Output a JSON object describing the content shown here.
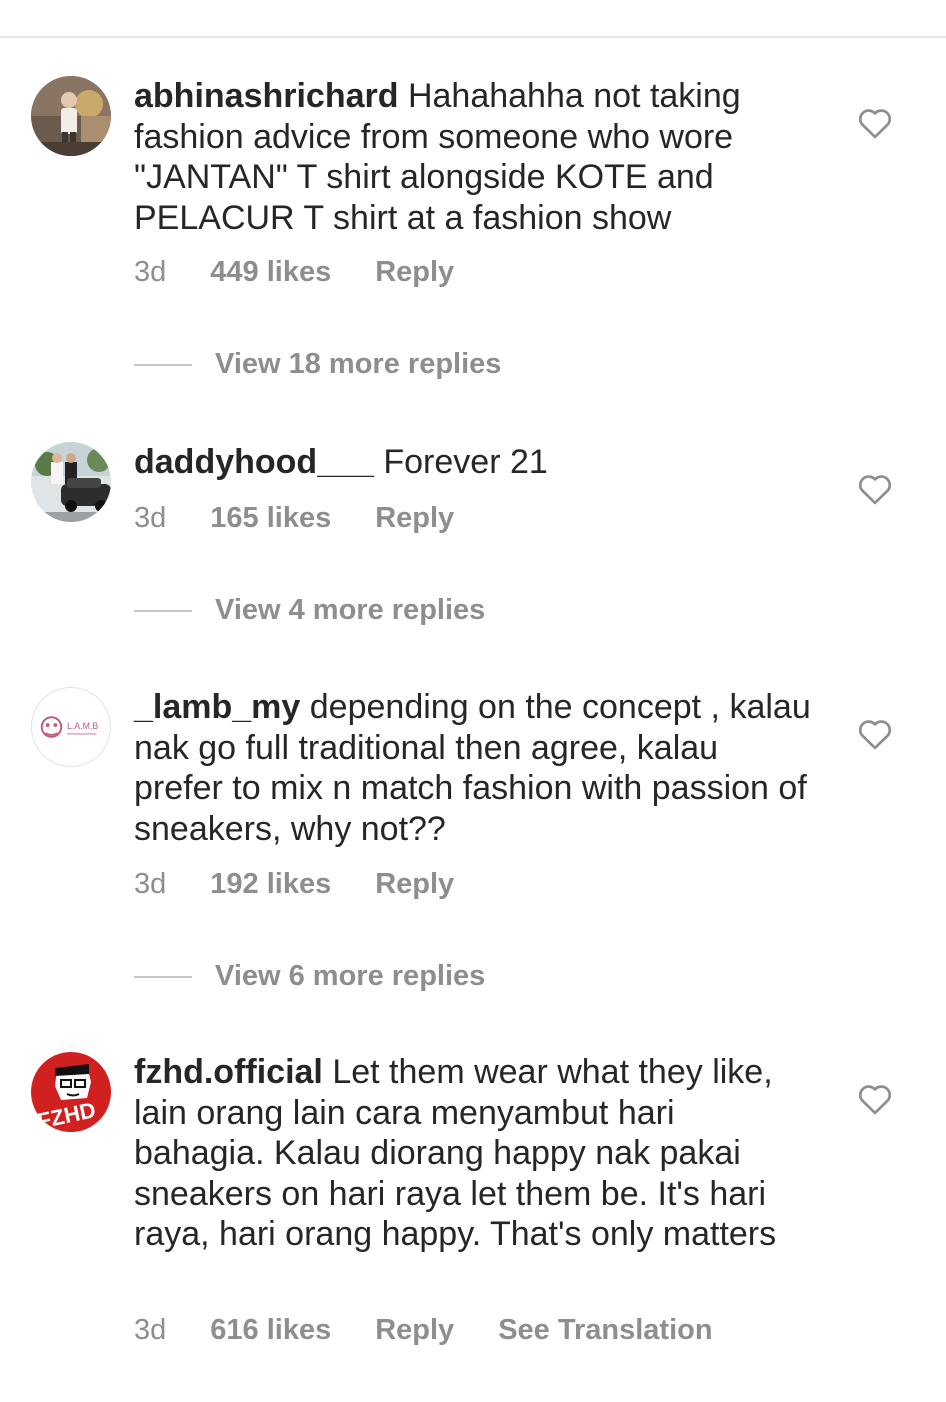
{
  "comments": [
    {
      "username": "abhinashrichard",
      "text": " Hahahahha not taking fashion advice from someone who wore \"JANTAN\" T shirt alongside KOTE and PELACUR T shirt at a fashion show",
      "time": "3d",
      "likes": "449 likes",
      "reply": "Reply",
      "view_replies": "View 18 more replies",
      "avatar_icon": "person-photo-avatar"
    },
    {
      "username": "daddyhood___",
      "text": " Forever 21",
      "time": "3d",
      "likes": "165 likes",
      "reply": "Reply",
      "view_replies": "View 4 more replies",
      "avatar_icon": "car-photo-avatar"
    },
    {
      "username": "_lamb_my",
      "text": " depending on the concept , kalau nak go full traditional then agree, kalau prefer to mix n match fashion with passion of sneakers, why not??",
      "time": "3d",
      "likes": "192 likes",
      "reply": "Reply",
      "view_replies": "View 6 more replies",
      "avatar_icon": "lamb-logo-avatar",
      "avatar_logo_text": "L.A.M.B"
    },
    {
      "username": "fzhd.official",
      "text": " Let them wear what they like, lain orang lain cara menyambut hari bahagia. Kalau diorang happy nak pakai sneakers on hari raya let them be. It's hari raya, hari orang happy. That's only matters",
      "time": "3d",
      "likes": "616 likes",
      "reply": "Reply",
      "see_translation": "See Translation",
      "avatar_icon": "fzhd-logo-avatar",
      "avatar_logo_text": "FZHD"
    }
  ],
  "colors": {
    "text": "#262626",
    "secondary": "#8e8e8e",
    "divider": "#e6e6e6",
    "fzhd_red": "#d0201f"
  },
  "icons": {
    "like": "heart-outline-icon"
  }
}
